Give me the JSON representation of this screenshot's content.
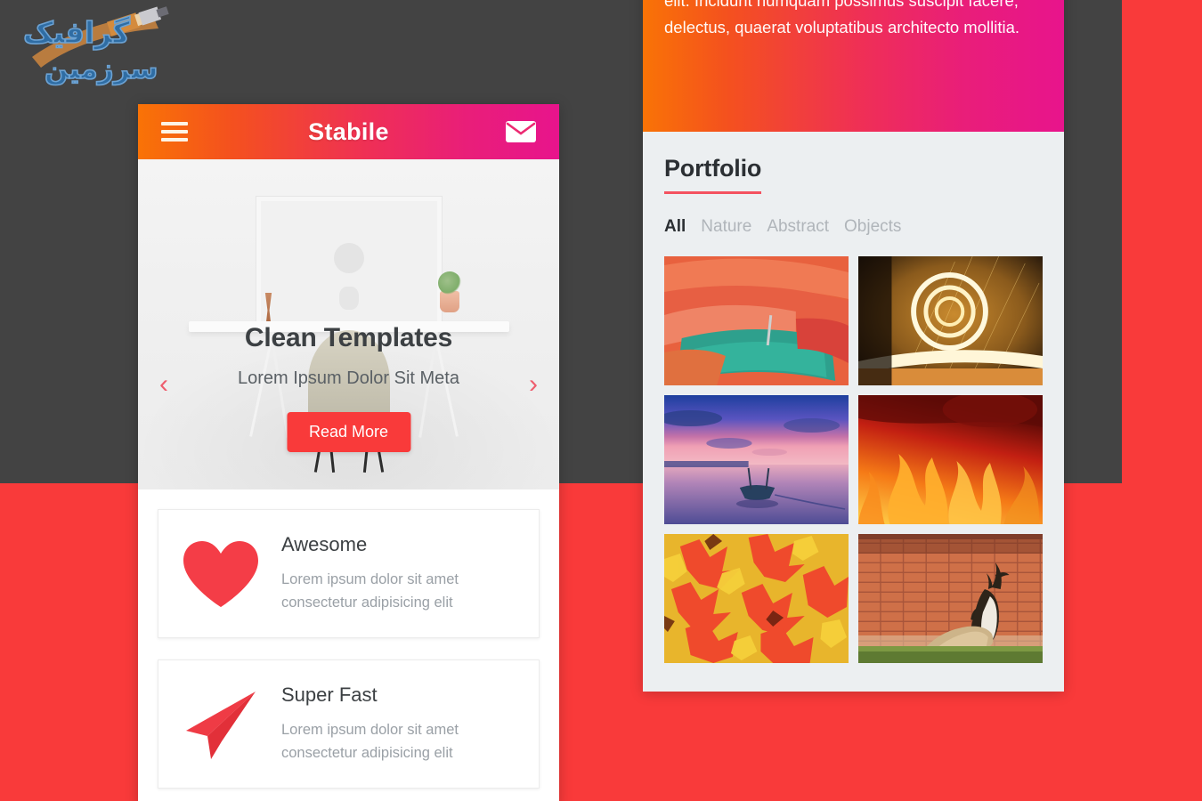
{
  "watermark": {
    "text_line1": "گرافیک",
    "text_line2": "سرزمین",
    "name": "graphic-watermark"
  },
  "colors": {
    "page_bg_red": "#f93a3a",
    "page_bg_dark": "#434343",
    "gradient_start": "#f97306",
    "gradient_end": "#e8148c",
    "accent_red": "#f93a3a",
    "panel_bg": "#eceff1",
    "heading": "#3c4043",
    "muted_text": "#9aa0a6",
    "filter_inactive": "#b0b5ba",
    "underline": "#f4525f"
  },
  "phone": {
    "header": {
      "title": "Stabile",
      "menu_icon": "hamburger-icon",
      "mail_icon": "envelope-icon"
    },
    "hero": {
      "title": "Clean Templates",
      "subtitle": "Lorem Ipsum Dolor Sit Meta",
      "cta_label": "Read More",
      "prev_arrow": "‹",
      "next_arrow": "›"
    },
    "features": [
      {
        "icon": "heart-icon",
        "title": "Awesome",
        "description": "Lorem ipsum dolor sit amet consectetur adipisicing elit"
      },
      {
        "icon": "paper-plane-icon",
        "title": "Super Fast",
        "description": "Lorem ipsum dolor sit amet consectetur adipisicing elit"
      }
    ]
  },
  "right_panel": {
    "intro_text": "Lorem ipsum dolor sit amet, consectetur adipisicing elit. Incidunt numquam possimus suscipit facere, delectus, quaerat voluptatibus architecto mollitia.",
    "portfolio": {
      "title": "Portfolio",
      "filters": [
        {
          "label": "All",
          "active": true
        },
        {
          "label": "Nature",
          "active": false
        },
        {
          "label": "Abstract",
          "active": false
        },
        {
          "label": "Objects",
          "active": false
        }
      ],
      "items": [
        {
          "name": "kayaks-photo",
          "alt": "Stacked orange and teal kayaks"
        },
        {
          "name": "light-spiral-photo",
          "alt": "Spinning sparkler light spiral"
        },
        {
          "name": "boat-sunset-photo",
          "alt": "Boat on calm water at purple sunset"
        },
        {
          "name": "fire-flames-photo",
          "alt": "Close-up of orange fire flames"
        },
        {
          "name": "autumn-leaves-photo",
          "alt": "Red and yellow autumn leaves"
        },
        {
          "name": "deer-brick-wall-photo",
          "alt": "Deer resting against a brick wall"
        }
      ]
    }
  }
}
